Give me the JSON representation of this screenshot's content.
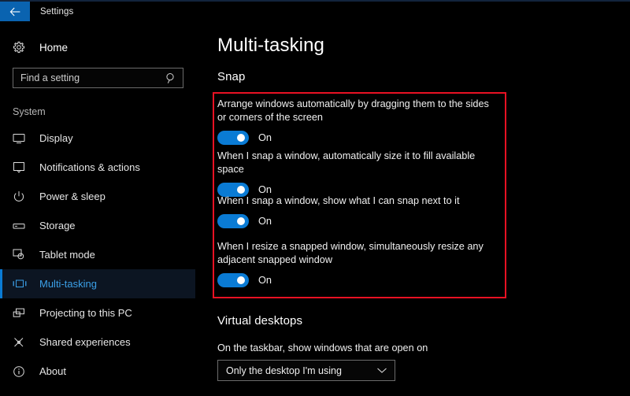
{
  "titlebar": {
    "back_icon": "back-arrow-icon",
    "title": "Settings"
  },
  "sidebar": {
    "home": {
      "label": "Home",
      "icon": "gear-icon"
    },
    "search": {
      "placeholder": "Find a setting",
      "value": "",
      "icon": "search-icon"
    },
    "group_label": "System",
    "items": [
      {
        "label": "Display",
        "icon": "monitor-icon",
        "selected": false
      },
      {
        "label": "Notifications & actions",
        "icon": "notification-icon",
        "selected": false
      },
      {
        "label": "Power & sleep",
        "icon": "power-icon",
        "selected": false
      },
      {
        "label": "Storage",
        "icon": "drive-icon",
        "selected": false
      },
      {
        "label": "Tablet mode",
        "icon": "tablet-icon",
        "selected": false
      },
      {
        "label": "Multi-tasking",
        "icon": "multitasking-icon",
        "selected": true
      },
      {
        "label": "Projecting to this PC",
        "icon": "projecting-icon",
        "selected": false
      },
      {
        "label": "Shared experiences",
        "icon": "share-icon",
        "selected": false
      },
      {
        "label": "About",
        "icon": "info-icon",
        "selected": false
      }
    ],
    "accent_color": "#0a7bd4"
  },
  "main": {
    "page_title": "Multi-tasking",
    "snap": {
      "heading": "Snap",
      "settings": [
        {
          "label": "Arrange windows automatically by dragging them to the sides or corners of the screen",
          "state": "On"
        },
        {
          "label": "When I snap a window, automatically size it to fill available space",
          "state": "On"
        },
        {
          "label": "When I snap a window, show what I can snap next to it",
          "state": "On"
        },
        {
          "label": "When I resize a snapped window, simultaneously resize any adjacent snapped window",
          "state": "On"
        }
      ]
    },
    "virtual_desktops": {
      "heading": "Virtual desktops",
      "description": "On the taskbar, show windows that are open on",
      "dropdown": {
        "value": "Only the desktop I'm using",
        "icon": "chevron-down-icon"
      }
    },
    "highlight_color": "#e81123"
  }
}
